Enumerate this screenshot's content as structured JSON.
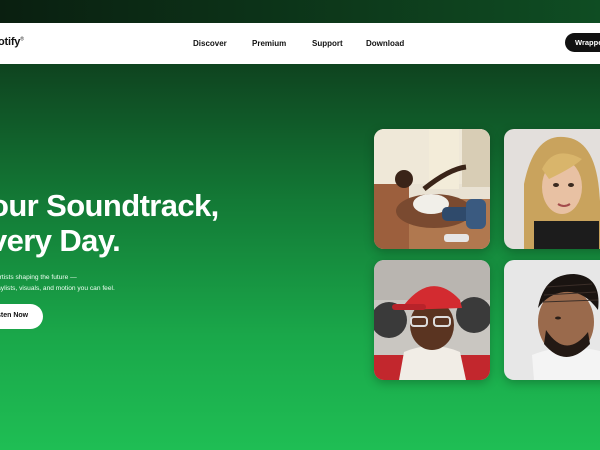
{
  "brand": {
    "logo_text": "otify",
    "logo_mark": "®"
  },
  "nav": {
    "links": [
      "Discover",
      "Premium",
      "Support",
      "Download"
    ],
    "cta_label": "Wrappe"
  },
  "hero": {
    "title_lines": [
      "our Soundtrack,",
      "very Day."
    ],
    "subtitle_lines": [
      "r artists shaping the future —",
      "playlists, visuals, and motion you can feel."
    ],
    "button_label": "sten Now"
  },
  "artists": {
    "photos": [
      "artist-photo-reclining",
      "artist-photo-blonde",
      "artist-photo-red-cap",
      "artist-photo-braids"
    ]
  },
  "colors": {
    "accent_green": "#1db954",
    "nav_background": "#ffffff",
    "button_dark": "#111111"
  }
}
